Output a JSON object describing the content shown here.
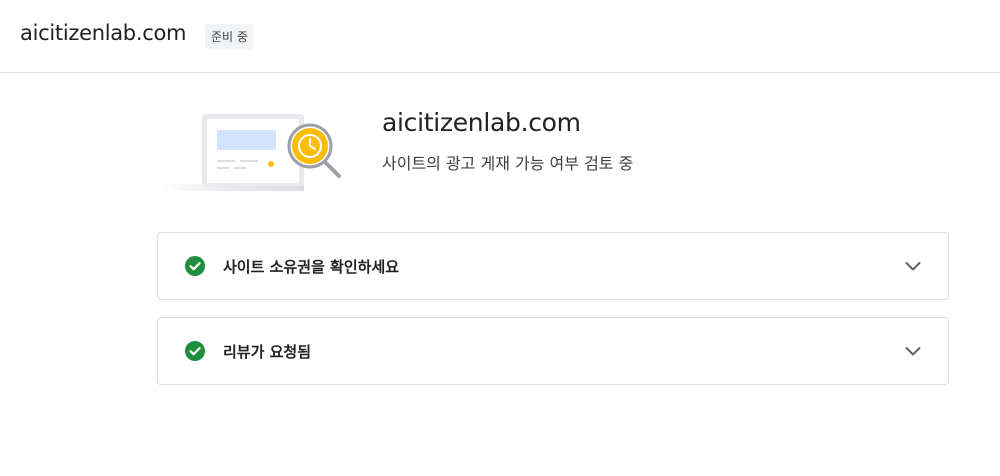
{
  "header": {
    "site_name": "aicitizenlab.com",
    "status_badge": "준비 중"
  },
  "hero": {
    "title": "aicitizenlab.com",
    "subtitle": "사이트의 광고 게재 가능 여부 검토 중"
  },
  "steps": [
    {
      "label": "사이트 소유권을 확인하세요",
      "status": "complete",
      "icon": "check-circle-icon"
    },
    {
      "label": "리뷰가 요청됨",
      "status": "complete",
      "icon": "check-circle-icon"
    }
  ],
  "colors": {
    "check_green": "#1e8e3e",
    "clock_yellow": "#fbbc04",
    "screen_blue": "#d2e3fc"
  }
}
